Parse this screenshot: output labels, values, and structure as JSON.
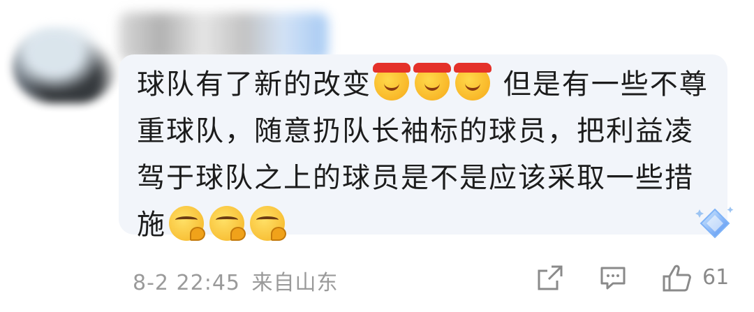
{
  "comment": {
    "segments": [
      {
        "type": "text",
        "value": "球队有了新的改变"
      },
      {
        "type": "emoji",
        "icon": "headband-smile-emoji"
      },
      {
        "type": "emoji",
        "icon": "headband-smile-emoji"
      },
      {
        "type": "emoji",
        "icon": "headband-smile-emoji"
      },
      {
        "type": "text",
        "value": " 但是有一些不尊重球队，随意扔队长袖标的球员，把利益凌驾于球队之上的球员是不是应该采取一些措施"
      },
      {
        "type": "emoji",
        "icon": "thinking-emoji"
      },
      {
        "type": "emoji",
        "icon": "thinking-emoji"
      },
      {
        "type": "emoji",
        "icon": "thinking-emoji"
      }
    ],
    "text_part1": "球队有了新的改变",
    "text_part2": " 但是有一些不尊重球队，随意扔队长袖标的球员，把利益凌驾于球队之上的球员是不是应该采取一些措施"
  },
  "meta": {
    "time": "8-2 22:45",
    "location": "来自山东"
  },
  "actions": {
    "share_icon": "share-icon",
    "reply_icon": "comment-icon",
    "like_icon": "thumbs-up-icon",
    "like_count": "61"
  },
  "colors": {
    "bubble": "#f2f5fa",
    "text": "#1c1c1c",
    "meta": "#9a9a9a",
    "accent": "#6fa8f5"
  }
}
